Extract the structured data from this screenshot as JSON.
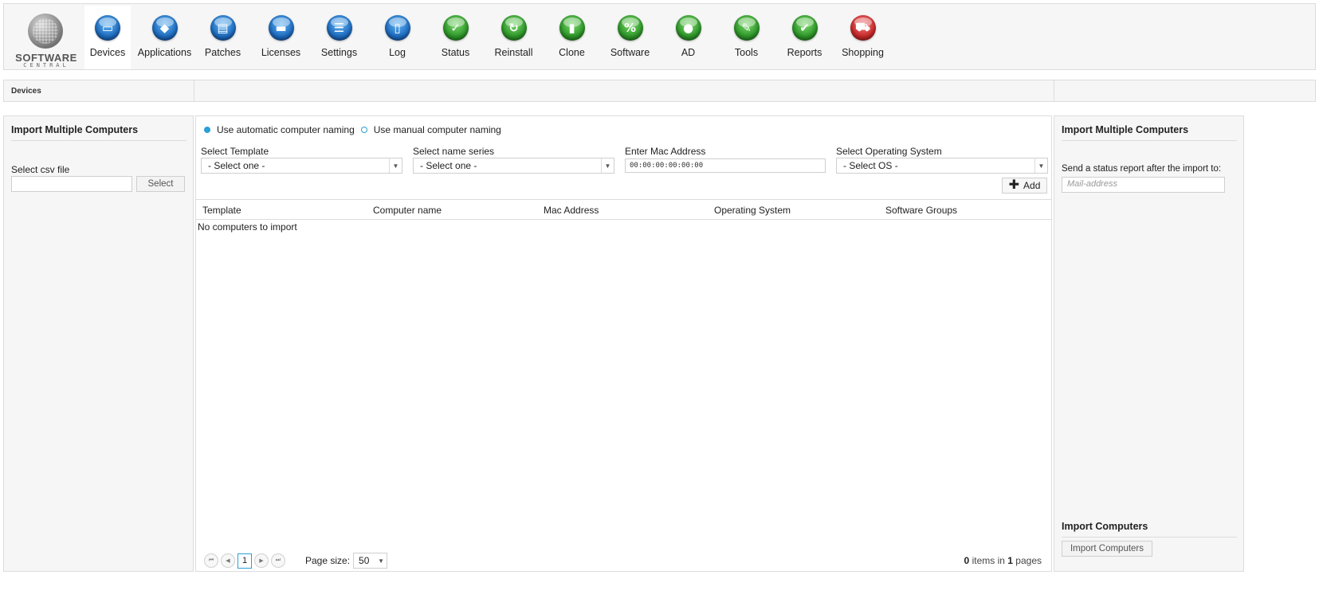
{
  "logo": {
    "line1": "SOFTWARE",
    "line2": "CENTRAL"
  },
  "nav": [
    {
      "label": "Devices",
      "icon": "monitor-icon",
      "color": "blue",
      "glyph": "▭",
      "active": true
    },
    {
      "label": "Applications",
      "icon": "applications-icon",
      "color": "blue",
      "glyph": "◆"
    },
    {
      "label": "Patches",
      "icon": "patches-icon",
      "color": "blue",
      "glyph": "▤"
    },
    {
      "label": "Licenses",
      "icon": "licenses-icon",
      "color": "blue",
      "glyph": "▬"
    },
    {
      "label": "Settings",
      "icon": "settings-icon",
      "color": "blue",
      "glyph": "☰"
    },
    {
      "label": "Log",
      "icon": "log-icon",
      "color": "blue",
      "glyph": "▯"
    },
    {
      "label": "Status",
      "icon": "checkmark-icon",
      "color": "green",
      "glyph": "✓"
    },
    {
      "label": "Reinstall",
      "icon": "refresh-icon",
      "color": "green",
      "glyph": "↻"
    },
    {
      "label": "Clone",
      "icon": "clone-icon",
      "color": "green",
      "glyph": "▮"
    },
    {
      "label": "Software",
      "icon": "percent-icon",
      "color": "green",
      "glyph": "%"
    },
    {
      "label": "AD",
      "icon": "users-icon",
      "color": "green",
      "glyph": "●"
    },
    {
      "label": "Tools",
      "icon": "wrench-icon",
      "color": "green",
      "glyph": "✎"
    },
    {
      "label": "Reports",
      "icon": "reports-icon",
      "color": "green",
      "glyph": "✔"
    },
    {
      "label": "Shopping",
      "icon": "cart-icon",
      "color": "red",
      "glyph": "⛟"
    }
  ],
  "breadcrumb": "Devices",
  "left_panel": {
    "title": "Import Multiple Computers",
    "csv_label": "Select csv file",
    "csv_value": "",
    "select_button": "Select"
  },
  "center": {
    "radio_auto": "Use automatic computer naming",
    "radio_manual": "Use manual computer naming",
    "template_label": "Select Template",
    "template_value": "- Select one -",
    "name_series_label": "Select name series",
    "name_series_value": "- Select one -",
    "mac_label": "Enter Mac Address",
    "mac_value": "00:00:00:00:00:00",
    "os_label": "Select Operating System",
    "os_value": "- Select OS -",
    "add_button": "Add",
    "columns": [
      "Template",
      "Computer name",
      "Mac Address",
      "Operating System",
      "Software Groups"
    ],
    "empty_message": "No computers to import",
    "pager": {
      "current_page": "1",
      "page_size_label": "Page size:",
      "page_size": "50",
      "items_count": "0",
      "items_text": "items in",
      "pages_count": "1",
      "pages_text": "pages"
    }
  },
  "right_panel": {
    "title": "Import Multiple Computers",
    "report_label": "Send a status report after the import to:",
    "mail_placeholder": "Mail-address",
    "import_title": "Import Computers",
    "import_button": "Import Computers"
  },
  "colors": {
    "accent": "#2a9fd8",
    "panel_bg": "#f6f6f6",
    "border": "#dcdcdc"
  }
}
